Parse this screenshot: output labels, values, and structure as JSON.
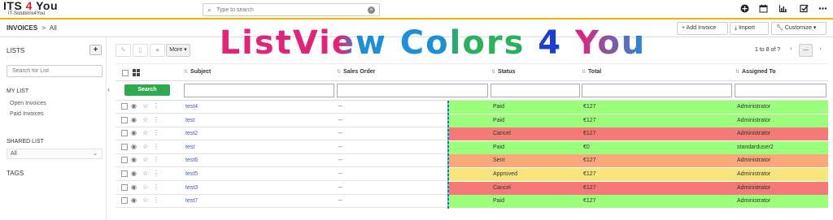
{
  "brand": {
    "name_part1": "ITS ",
    "name_part2": "4",
    "name_part3": " You",
    "tagline": "IT-Solutions4You"
  },
  "search": {
    "placeholder": "Type to search"
  },
  "top_icons": [
    "plus-circle-icon",
    "calendar-icon",
    "bar-chart-icon",
    "checkbox-icon",
    "ellipsis-icon"
  ],
  "breadcrumb": {
    "module": "INVOICES",
    "separator": ">",
    "current": "All"
  },
  "header_buttons": {
    "add": "+ Add Invoice",
    "import": "Import",
    "customize": "Customize"
  },
  "banner": {
    "text": "ListView Colors 4 You"
  },
  "sidebar": {
    "lists_title": "LISTS",
    "add_label": "+",
    "search_placeholder": "Search for List",
    "my_list_title": "MY LIST",
    "my_list_items": [
      "Open Invoices",
      "Paid Invoices"
    ],
    "shared_list_title": "SHARED LIST",
    "shared_selected": "All",
    "tags_title": "TAGS"
  },
  "actions": {
    "more": "More"
  },
  "pagination": {
    "text": "1 to 8  of ?",
    "prev": "‹",
    "next": "›",
    "menu": "—"
  },
  "table": {
    "search_button": "Search",
    "columns": [
      "Subject",
      "Sales Order",
      "Status",
      "Total",
      "Assigned To"
    ],
    "rows": [
      {
        "subject": "test4",
        "sales_order": "--",
        "status": "Paid",
        "total": "€127",
        "assigned": "Administrator"
      },
      {
        "subject": "test",
        "sales_order": "--",
        "status": "Paid",
        "total": "€127",
        "assigned": "Administrator"
      },
      {
        "subject": "test2",
        "sales_order": "--",
        "status": "Cancel",
        "total": "€127",
        "assigned": "Administrator"
      },
      {
        "subject": "test",
        "sales_order": "--",
        "status": "Paid",
        "total": "€0",
        "assigned": "standarduser2"
      },
      {
        "subject": "test6",
        "sales_order": "--",
        "status": "Sent",
        "total": "€127",
        "assigned": "Administrator"
      },
      {
        "subject": "test5",
        "sales_order": "--",
        "status": "Approved",
        "total": "€127",
        "assigned": "Administrator"
      },
      {
        "subject": "test3",
        "sales_order": "--",
        "status": "Cancel",
        "total": "€127",
        "assigned": "Administrator"
      },
      {
        "subject": "test7",
        "sales_order": "--",
        "status": "Paid",
        "total": "€127",
        "assigned": "Administrator"
      }
    ]
  },
  "status_colors": {
    "Paid": "#9cff7c",
    "Cancel": "#f47a77",
    "Sent": "#f8a87a",
    "Approved": "#f6e57c"
  },
  "colors": {
    "accent_yellow": "#e6b800",
    "search_green": "#2fa84f",
    "link_blue": "#3b5bb5"
  }
}
